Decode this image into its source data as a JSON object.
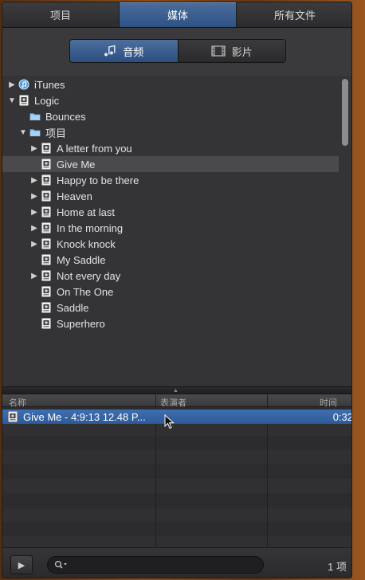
{
  "tabs": [
    {
      "label": "项目",
      "active": false
    },
    {
      "label": "媒体",
      "active": true
    },
    {
      "label": "所有文件",
      "active": false
    }
  ],
  "segment": {
    "audio_label": "音频",
    "movies_label": "影片"
  },
  "tree": [
    {
      "label": "iTunes",
      "icon": "itunes-icon",
      "disclosure": "collapsed",
      "level": 0
    },
    {
      "label": "Logic",
      "icon": "logic-project-icon",
      "disclosure": "expanded",
      "level": 0
    },
    {
      "label": "Bounces",
      "icon": "folder-icon",
      "disclosure": "none",
      "level": 1
    },
    {
      "label": "项目",
      "icon": "folder-icon",
      "disclosure": "expanded",
      "level": 1
    },
    {
      "label": "A letter from you",
      "icon": "logic-project-icon",
      "disclosure": "collapsed",
      "level": 2
    },
    {
      "label": "Give Me",
      "icon": "logic-project-icon",
      "disclosure": "none",
      "level": 2,
      "selected": true
    },
    {
      "label": "Happy to be there",
      "icon": "logic-project-icon",
      "disclosure": "collapsed",
      "level": 2
    },
    {
      "label": "Heaven",
      "icon": "logic-project-icon",
      "disclosure": "collapsed",
      "level": 2
    },
    {
      "label": "Home at last",
      "icon": "logic-project-icon",
      "disclosure": "collapsed",
      "level": 2
    },
    {
      "label": "In the morning",
      "icon": "logic-project-icon",
      "disclosure": "collapsed",
      "level": 2
    },
    {
      "label": "Knock knock",
      "icon": "logic-project-icon",
      "disclosure": "collapsed",
      "level": 2
    },
    {
      "label": "My Saddle",
      "icon": "logic-project-icon",
      "disclosure": "none",
      "level": 2
    },
    {
      "label": "Not every day",
      "icon": "logic-project-icon",
      "disclosure": "collapsed",
      "level": 2
    },
    {
      "label": "On The One",
      "icon": "logic-project-icon",
      "disclosure": "none",
      "level": 2
    },
    {
      "label": "Saddle",
      "icon": "logic-project-icon",
      "disclosure": "none",
      "level": 2
    },
    {
      "label": "Superhero",
      "icon": "logic-project-icon",
      "disclosure": "none",
      "level": 2
    }
  ],
  "list": {
    "columns": {
      "name": "名称",
      "artist": "表演者",
      "time": "时间"
    },
    "rows": [
      {
        "name": "Give Me - 4:9:13 12.48 P...",
        "artist": "",
        "time": "0:32",
        "selected": true
      }
    ]
  },
  "bottom": {
    "search_placeholder": "",
    "count": "1 项"
  },
  "colors": {
    "accent": "#3e6aa8",
    "panel": "#2f2f31"
  }
}
